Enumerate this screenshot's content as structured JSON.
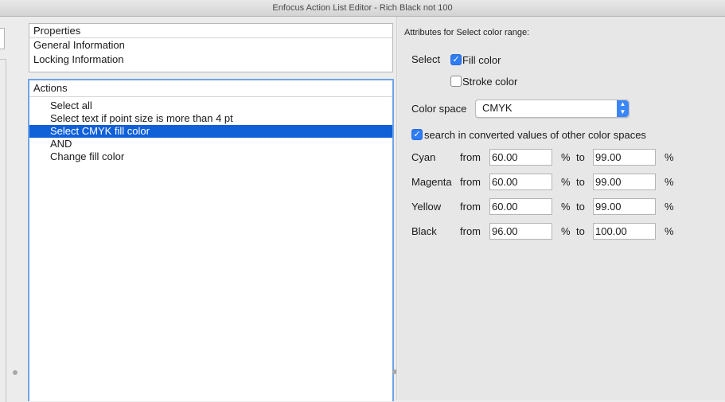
{
  "window": {
    "title": "Enfocus Action List Editor - Rich Black not 100"
  },
  "properties": {
    "header": "Properties",
    "items": [
      "General Information",
      "Locking Information"
    ]
  },
  "actions": {
    "header": "Actions",
    "items": [
      "Select all",
      "Select text if point size is more than 4 pt",
      "Select CMYK fill color",
      "AND",
      "Change fill color"
    ],
    "selected_index": 2
  },
  "attributes": {
    "title": "Attributes for Select color range:",
    "select_label": "Select",
    "fill_color": {
      "label": "Fill color",
      "checked": true
    },
    "stroke_color": {
      "label": "Stroke color",
      "checked": false
    },
    "color_space_label": "Color space",
    "color_space_value": "CMYK",
    "converted": {
      "label": "search in converted values of other color spaces",
      "checked": true
    },
    "from_label": "from",
    "percent": "%",
    "to_label": "to",
    "rows": [
      {
        "name": "Cyan",
        "from": "60.00",
        "to": "99.00"
      },
      {
        "name": "Magenta",
        "from": "60.00",
        "to": "99.00"
      },
      {
        "name": "Yellow",
        "from": "60.00",
        "to": "99.00"
      },
      {
        "name": "Black",
        "from": "96.00",
        "to": "100.00"
      }
    ]
  },
  "colors": {
    "selection": "#1060d8",
    "checkbox_accent": "#2e7cf6",
    "focus_ring": "#6fa4e6"
  }
}
